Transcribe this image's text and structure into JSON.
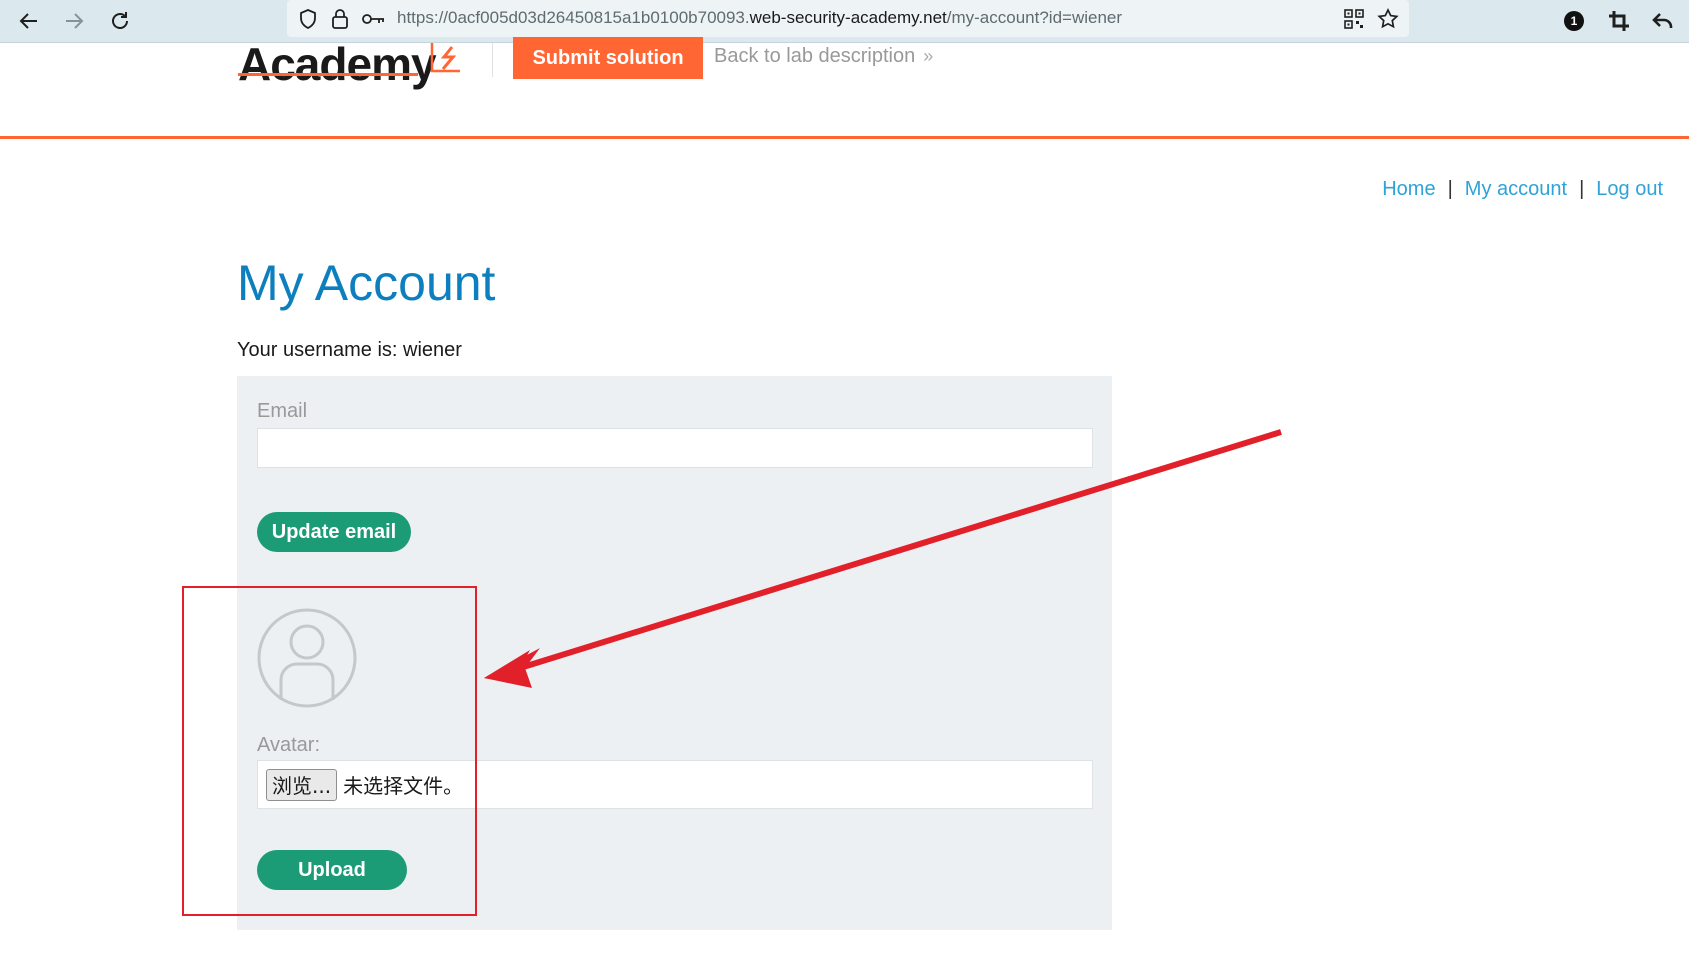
{
  "browser": {
    "url_prefix": "https://0acf005d03d26450815a1b0100b70093.",
    "url_domain": "web-security-academy.net",
    "url_path": "/my-account?id=wiener",
    "extension_badge": "1"
  },
  "header": {
    "logo_text": "Academy",
    "submit_label": "Submit solution",
    "back_label": "Back to lab description",
    "back_chevron": "»"
  },
  "nav": {
    "home": "Home",
    "my_account": "My account",
    "log_out": "Log out",
    "separator": "|"
  },
  "account": {
    "title": "My Account",
    "username_line": "Your username is: wiener",
    "email_label": "Email",
    "email_value": "",
    "update_email_label": "Update email",
    "avatar_label": "Avatar:",
    "browse_label": "浏览...",
    "no_file_text": "未选择文件。",
    "upload_label": "Upload"
  },
  "colors": {
    "accent_orange": "#ff6633",
    "title_blue": "#0d7fbf",
    "link_blue": "#2ea3d8",
    "button_green": "#1b9c77",
    "annotation_red": "#e2202a"
  }
}
